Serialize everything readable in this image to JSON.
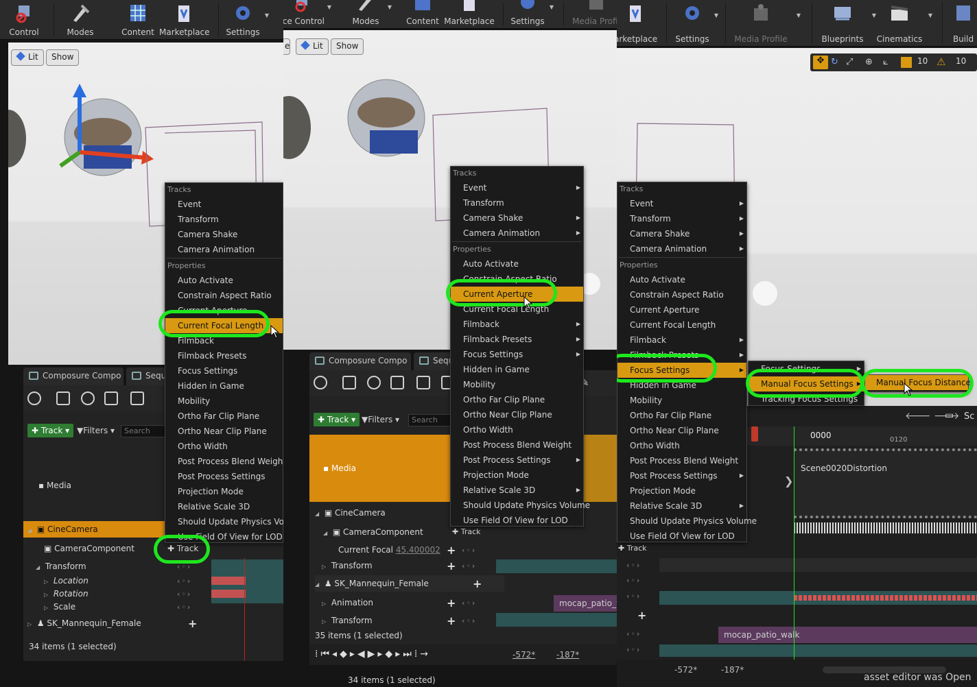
{
  "panels": [
    {
      "toolbar": [
        "Control",
        "Modes",
        "Content",
        "Marketplace",
        "Settings"
      ],
      "view_buttons": [
        "Lit",
        "Show"
      ],
      "tabs": [
        "Composure Compo",
        "Sequ"
      ],
      "track_button": "Track",
      "filters": "Filters",
      "search_placeholder": "Search",
      "menu_header_tracks": "Tracks",
      "menu_tracks": [
        "Event",
        "Transform",
        "Camera Shake",
        "Camera Animation"
      ],
      "menu_header_properties": "Properties",
      "menu_properties": [
        "Auto Activate",
        "Constrain Aspect Ratio",
        "Current Aperture",
        "Current Focal Length",
        "Filmback",
        "Filmback Presets",
        "Focus Settings",
        "Hidden in Game",
        "Mobility",
        "Ortho Far Clip Plane",
        "Ortho Near Clip Plane",
        "Ortho Width",
        "Post Process Blend Weight",
        "Post Process Settings",
        "Projection Mode",
        "Relative Scale 3D",
        "Should Update Physics Volu",
        "Use Field Of View for LOD"
      ],
      "highlighted": "Current Focal Length",
      "outliner": {
        "media": "Media",
        "cinecamera": "CineCamera",
        "camera_component": "CameraComponent",
        "track_label": "Track",
        "transform": "Transform",
        "location": "Location",
        "rotation": "Rotation",
        "scale": "Scale",
        "mannequin": "SK_Mannequin_Female"
      },
      "status": "34 items (1 selected)"
    },
    {
      "toolbar": [
        "rce Control",
        "Modes",
        "Content",
        "Marketplace",
        "Settings",
        "Media Profil"
      ],
      "view_buttons": [
        "e",
        "Lit",
        "Show"
      ],
      "tabs": [
        "Composure Compo",
        "Sequ"
      ],
      "track_button": "Track",
      "filters": "Filters",
      "search_placeholder": "Search",
      "menu_header_tracks": "Tracks",
      "menu_tracks": [
        "Event",
        "Transform",
        "Camera Shake",
        "Camera Animation"
      ],
      "menu_header_properties": "Properties",
      "menu_properties": [
        "Auto Activate",
        "Constrain Aspect Ratio",
        "Current Aperture",
        "Current Focal Length",
        "Filmback",
        "Filmback Presets",
        "Focus Settings",
        "Hidden in Game",
        "Mobility",
        "Ortho Far Clip Plane",
        "Ortho Near Clip Plane",
        "Ortho Width",
        "Post Process Blend Weight",
        "Post Process Settings",
        "Projection Mode",
        "Relative Scale 3D",
        "Should Update Physics Volume",
        "Use Field Of View for LOD"
      ],
      "highlighted": "Current Aperture",
      "outliner": {
        "media": "Media",
        "cinecamera": "CineCamera",
        "camera_component": "CameraComponent",
        "track_label": "Track",
        "current_focal": "Current Focal",
        "current_focal_value": "45.400002",
        "transform": "Transform",
        "mannequin": "SK_Mannequin_Female",
        "animation": "Animation",
        "transform2": "Transform",
        "clip": "mocap_patio_w"
      },
      "status": "35 items (1 selected)",
      "status2": "34 items (1 selected)",
      "range_start": "-572*",
      "range_end": "-187*"
    },
    {
      "toolbar": [
        "arketplace",
        "Settings",
        "Media Profile",
        "Blueprints",
        "Cinematics",
        "Build"
      ],
      "viewport_num": [
        "10",
        "10"
      ],
      "menu_header_tracks": "Tracks",
      "menu_tracks": [
        "Event",
        "Transform",
        "Camera Shake",
        "Camera Animation"
      ],
      "menu_header_properties": "Properties",
      "menu_properties": [
        "Auto Activate",
        "Constrain Aspect Ratio",
        "Current Aperture",
        "Current Focal Length",
        "Filmback",
        "Filmback Presets",
        "Focus Settings",
        "Hidden in Game",
        "Mobility",
        "Ortho Far Clip Plane",
        "Ortho Near Clip Plane",
        "Ortho Width",
        "Post Process Blend Weight",
        "Post Process Settings",
        "Projection Mode",
        "Relative Scale 3D",
        "Should Update Physics Volume",
        "Use Field Of View for LOD"
      ],
      "highlighted": "Focus Settings",
      "submenu1": [
        "Focus Settings",
        "Manual Focus Settings",
        "Tracking Focus Settings"
      ],
      "submenu1_highlighted": "Manual Focus Settings",
      "submenu2": [
        "Manual Focus Distance"
      ],
      "timeline": {
        "frame": "0000",
        "tick": "0120",
        "shot": "Scene0020Distortion",
        "track_label": "Track",
        "clip": "mocap_patio_walk",
        "range_start": "-572*",
        "range_end": "-187*",
        "sc": "Sc",
        "notice": "asset editor was Open"
      }
    }
  ],
  "colors": {
    "highlight": "#d99a12",
    "ring": "#1ee61e",
    "selected_row": "#d98b0e",
    "track_button": "#2e7d32"
  }
}
